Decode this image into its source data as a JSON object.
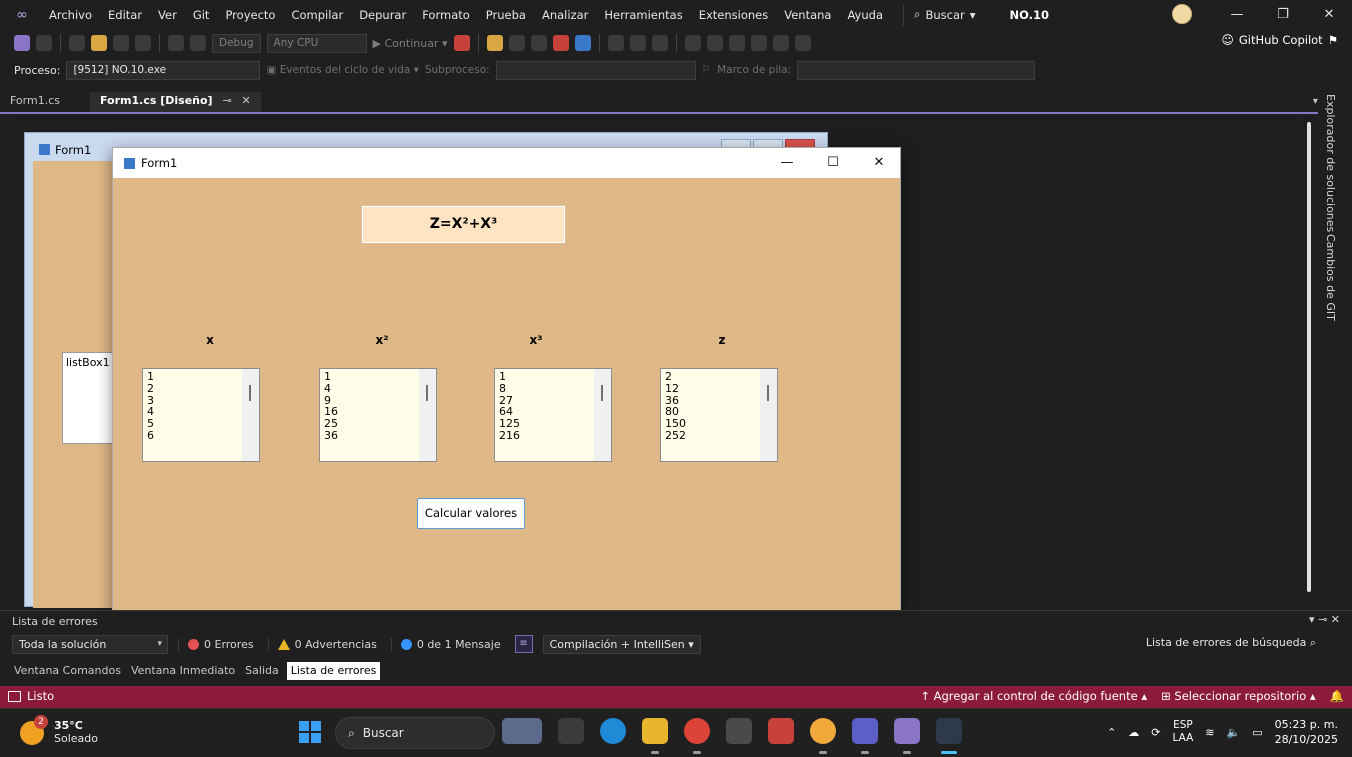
{
  "menu": {
    "items": [
      "Archivo",
      "Editar",
      "Ver",
      "Git",
      "Proyecto",
      "Compilar",
      "Depurar",
      "Formato",
      "Prueba",
      "Analizar",
      "Herramientas",
      "Extensiones",
      "Ventana",
      "Ayuda"
    ],
    "search_label": "Buscar",
    "project_name": "NO.10"
  },
  "toolbar": {
    "config": "Debug",
    "platform": "Any CPU",
    "continue_label": "Continuar",
    "copilot_label": "GitHub Copilot"
  },
  "debug_bar": {
    "process_label": "Proceso:",
    "process_value": "[9512] NO.10.exe",
    "lifecycle_label": "Eventos del ciclo de vida",
    "thread_label": "Subproceso:",
    "stack_label": "Marco de pila:"
  },
  "tabs": [
    {
      "label": "Form1.cs"
    },
    {
      "label": "Form1.cs [Diseño]"
    }
  ],
  "side_panels": [
    "Explorador de soluciones",
    "Cambios de GIT"
  ],
  "design_form": {
    "title": "Form1",
    "listbox_label": "listBox1"
  },
  "app_form": {
    "title": "Form1",
    "formula": "Z=X²+X³",
    "columns": [
      {
        "label": "x",
        "values": [
          "1",
          "2",
          "3",
          "4",
          "5",
          "6"
        ]
      },
      {
        "label": "x²",
        "values": [
          "1",
          "4",
          "9",
          "16",
          "25",
          "36"
        ]
      },
      {
        "label": "x³",
        "values": [
          "1",
          "8",
          "27",
          "64",
          "125",
          "216"
        ]
      },
      {
        "label": "z",
        "values": [
          "2",
          "12",
          "36",
          "80",
          "150",
          "252"
        ]
      }
    ],
    "button_label": "Calcular valores"
  },
  "error_list": {
    "title": "Lista de errores",
    "scope": "Toda la solución",
    "errors": "0 Errores",
    "warnings": "0 Advertencias",
    "messages": "0 de 1 Mensaje",
    "build_filter": "Compilación + IntelliSen",
    "search_placeholder": "Lista de errores de búsqueda"
  },
  "bottom_tabs": [
    "Ventana Comandos",
    "Ventana Inmediato",
    "Salida",
    "Lista de errores"
  ],
  "status": {
    "ready": "Listo",
    "source_control": "Agregar al control de código fuente",
    "repo": "Seleccionar repositorio"
  },
  "taskbar": {
    "weather_badge": "2",
    "temperature": "35°C",
    "weather_desc": "Soleado",
    "search_label": "Buscar",
    "language": "ESP",
    "language_sub": "LAA",
    "time": "05:23 p. m.",
    "date": "28/10/2025"
  },
  "colors": {
    "form_background": "#deb887",
    "formula_background": "#ffe4c4",
    "listbox_background": "#fffde7",
    "statusbar": "#8c1a3a",
    "accent": "#8a74c6"
  }
}
